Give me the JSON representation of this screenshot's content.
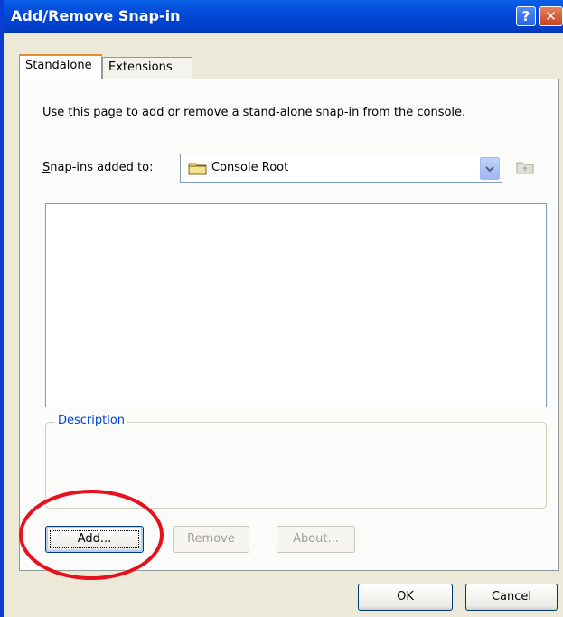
{
  "window": {
    "title": "Add/Remove Snap-in",
    "help_glyph": "?",
    "close_glyph": "✕"
  },
  "tabs": [
    {
      "label": "Standalone",
      "active": true
    },
    {
      "label": "Extensions",
      "active": false
    }
  ],
  "panel": {
    "description_text": "Use this page to add or remove a stand-alone snap-in from the console.",
    "snapins_label": "Snap-ins added to:",
    "combo_value": "Console Root",
    "description_group_label": "Description"
  },
  "buttons": {
    "add": "Add...",
    "remove": "Remove",
    "about": "About...",
    "ok": "OK",
    "cancel": "Cancel"
  },
  "colors": {
    "titlebar": "#0349d9",
    "annotation": "#e8101c",
    "group_label": "#0046d5"
  },
  "icons": [
    "help-icon",
    "close-icon",
    "folder-icon",
    "dropdown-arrow-icon",
    "up-folder-icon"
  ]
}
